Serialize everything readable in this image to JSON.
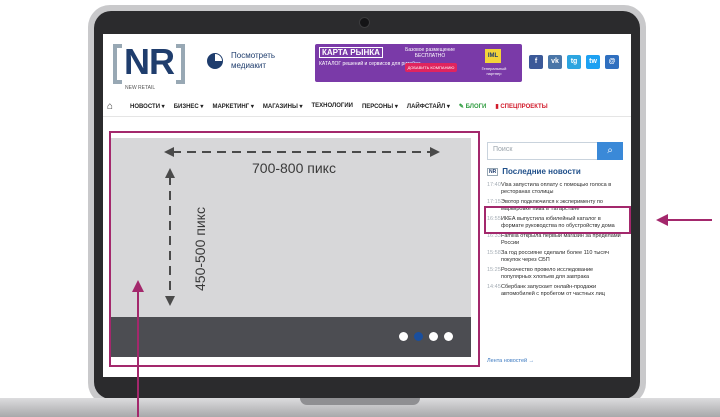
{
  "site": {
    "logo_text": "NR",
    "logo_sub": "NEW RETAIL",
    "media_kit": "Посмотреть медиакит"
  },
  "banner": {
    "logo": "КАРТА РЫНКА",
    "catalog": "КАТАЛОГ решений и сервисов для ритейла",
    "text": "Базовое размещение БЕСПЛАТНО",
    "button": "ДОБАВИТЬ КОМПАНИЮ",
    "partner_logo": "IML",
    "partner_text": "Генеральный партнер"
  },
  "social": [
    {
      "label": "f",
      "color": "#3b5998"
    },
    {
      "label": "vk",
      "color": "#4a76a8"
    },
    {
      "label": "tg",
      "color": "#2ca5e0"
    },
    {
      "label": "tw",
      "color": "#1da1f2"
    },
    {
      "label": "@",
      "color": "#2f6fbf"
    }
  ],
  "nav": {
    "items": [
      "НОВОСТИ",
      "БИЗНЕС",
      "МАРКЕТИНГ",
      "МАГАЗИНЫ",
      "ТЕХНОЛОГИИ",
      "ПЕРСОНЫ",
      "ЛАЙФСТАЙЛ"
    ],
    "blogs": "БЛОГИ",
    "special": "СПЕЦПРОЕКТЫ"
  },
  "slider": {
    "width_label": "700-800 пикс",
    "height_label": "450-500 пикс",
    "dots": 4,
    "active_dot": 1
  },
  "sidebar": {
    "search_placeholder": "Поиск",
    "news_title": "Последние новости",
    "news": [
      {
        "time": "17:40",
        "text": "Visa запустила оплату с помощью голоса в ресторанах столицы"
      },
      {
        "time": "17:15",
        "text": "Эвотор подключился к эксперименту по маркировке пива в Татарстане"
      },
      {
        "time": "16:55",
        "text": "ИКЕА выпустила юбилейный каталог в формате руководства по обустройству дома"
      },
      {
        "time": "16:33",
        "text": "Familia открыла первый магазин за пределами России"
      },
      {
        "time": "15:58",
        "text": "За год россияне сделали более 110 тысяч покупок через СБП"
      },
      {
        "time": "15:25",
        "text": "Роскачество провело исследование популярных хлопьев для завтрака"
      },
      {
        "time": "14:45",
        "text": "Сбербанк запускает онлайн-продажи автомобилей с пробегом от частных лиц"
      }
    ],
    "all_news": "Лента новостей →"
  },
  "colors": {
    "accent": "#a3286c",
    "brand": "#1f3d6d"
  }
}
